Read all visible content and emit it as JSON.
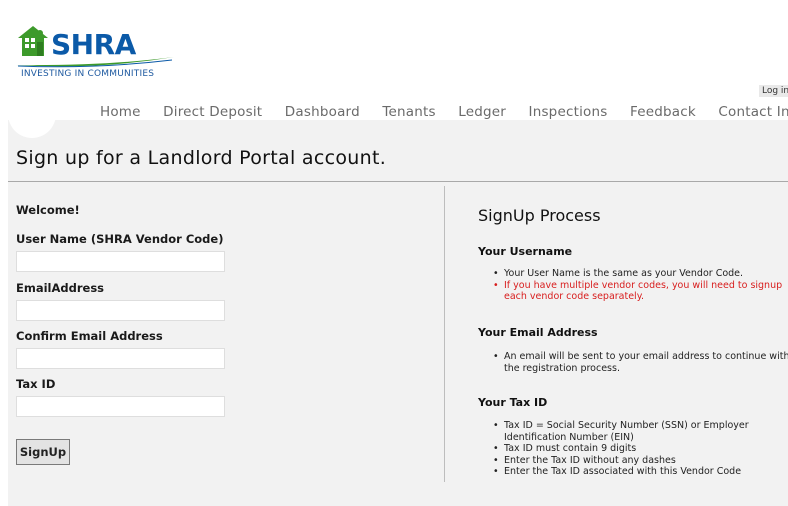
{
  "brand": {
    "name": "SHRA",
    "tagline": "INVESTING IN COMMUNITIES",
    "blue": "#0b5aa8",
    "green": "#3d9a2b"
  },
  "header": {
    "login_label": "Log in"
  },
  "nav": {
    "items": [
      "Home",
      "Direct Deposit",
      "Dashboard",
      "Tenants",
      "Ledger",
      "Inspections",
      "Feedback",
      "Contact Info"
    ]
  },
  "page": {
    "title": "Sign up for a Landlord Portal account."
  },
  "form": {
    "welcome": "Welcome!",
    "username_label": "User Name (SHRA Vendor Code)",
    "username_value": "",
    "email_label": "EmailAddress",
    "email_value": "",
    "confirm_email_label": "Confirm Email Address",
    "confirm_email_value": "",
    "taxid_label": "Tax ID",
    "taxid_value": "",
    "submit_label": "SignUp"
  },
  "process": {
    "title": "SignUp Process",
    "sections": [
      {
        "heading": "Your Username",
        "items": [
          "Your User Name is the same as your Vendor Code.",
          "If you have multiple vendor codes, you will need to signup each vendor code separately."
        ]
      },
      {
        "heading": "Your Email Address",
        "items": [
          "An email will be sent to your email address to continue with the registration process."
        ]
      },
      {
        "heading": "Your Tax ID",
        "items": [
          "Tax ID = Social Security Number (SSN) or Employer Identification Number (EIN)",
          "Tax ID must contain 9 digits",
          "Enter the Tax ID without any dashes",
          "Enter the Tax ID associated with this Vendor Code"
        ]
      }
    ],
    "warning_color": "#d81e1e"
  }
}
